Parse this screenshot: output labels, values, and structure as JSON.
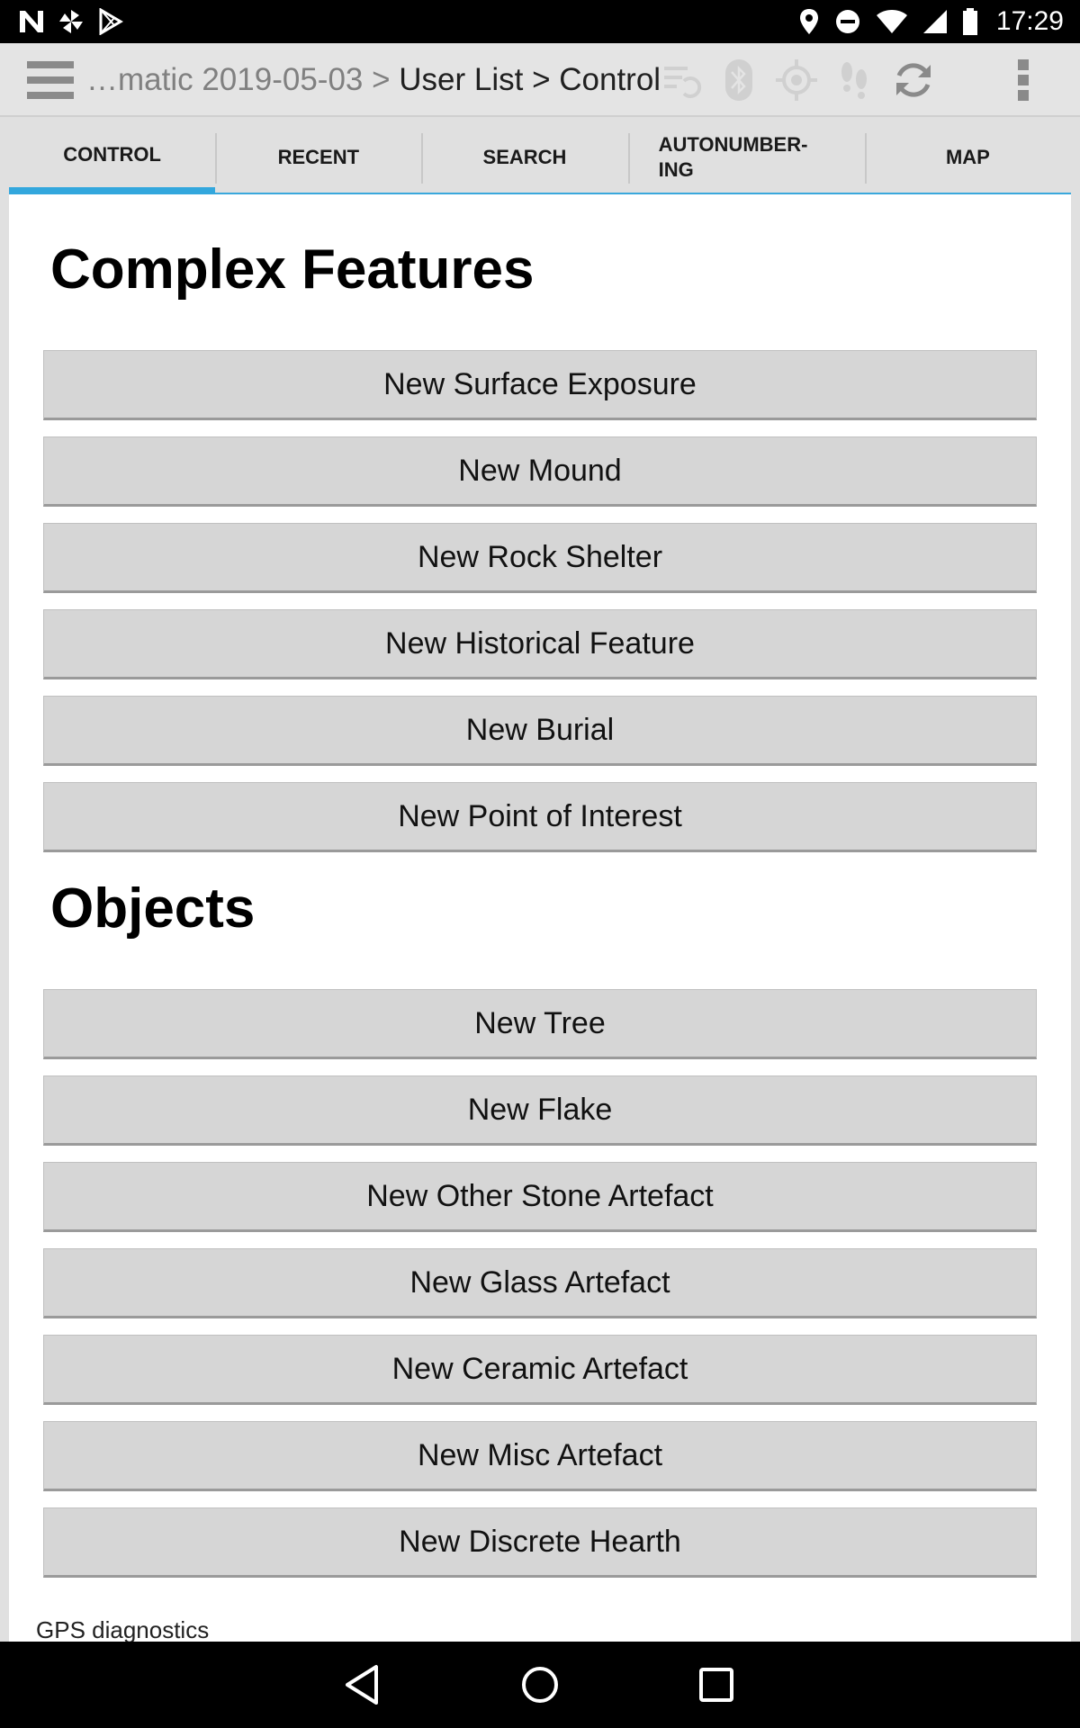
{
  "status_bar": {
    "time": "17:29",
    "left_icons": [
      "n-notification-icon",
      "pinwheel-icon",
      "play-store-icon"
    ],
    "right_icons": [
      "location-pin-icon",
      "do-not-disturb-icon",
      "wifi-icon",
      "cellular-signal-icon",
      "battery-icon"
    ]
  },
  "action_bar": {
    "breadcrumb_prefix": "…matic 2019-05-03 > ",
    "breadcrumb_main": "User List > Control",
    "icons": [
      "sync-data-icon",
      "bluetooth-icon",
      "gps-target-icon",
      "footsteps-icon",
      "refresh-icon",
      "overflow-menu-icon"
    ]
  },
  "tabs": [
    {
      "label": "CONTROL",
      "active": true
    },
    {
      "label": "RECENT"
    },
    {
      "label": "SEARCH"
    },
    {
      "label": "AUTONUMBER-\nING"
    },
    {
      "label": "MAP"
    }
  ],
  "sections": {
    "complex_features": {
      "title": "Complex Features",
      "buttons": [
        "New Surface Exposure",
        "New Mound",
        "New Rock Shelter",
        "New Historical Feature",
        "New Burial",
        "New Point of Interest"
      ]
    },
    "objects": {
      "title": "Objects",
      "buttons": [
        "New Tree",
        "New Flake",
        "New Other Stone Artefact",
        "New Glass Artefact",
        "New Ceramic Artefact",
        "New Misc Artefact",
        "New Discrete Hearth"
      ]
    }
  },
  "footer": {
    "gps_diagnostics": "GPS diagnostics"
  },
  "colors": {
    "accent": "#33a7dd",
    "button_bg": "#d6d6d6",
    "action_bar_bg": "#e4e4e4"
  }
}
